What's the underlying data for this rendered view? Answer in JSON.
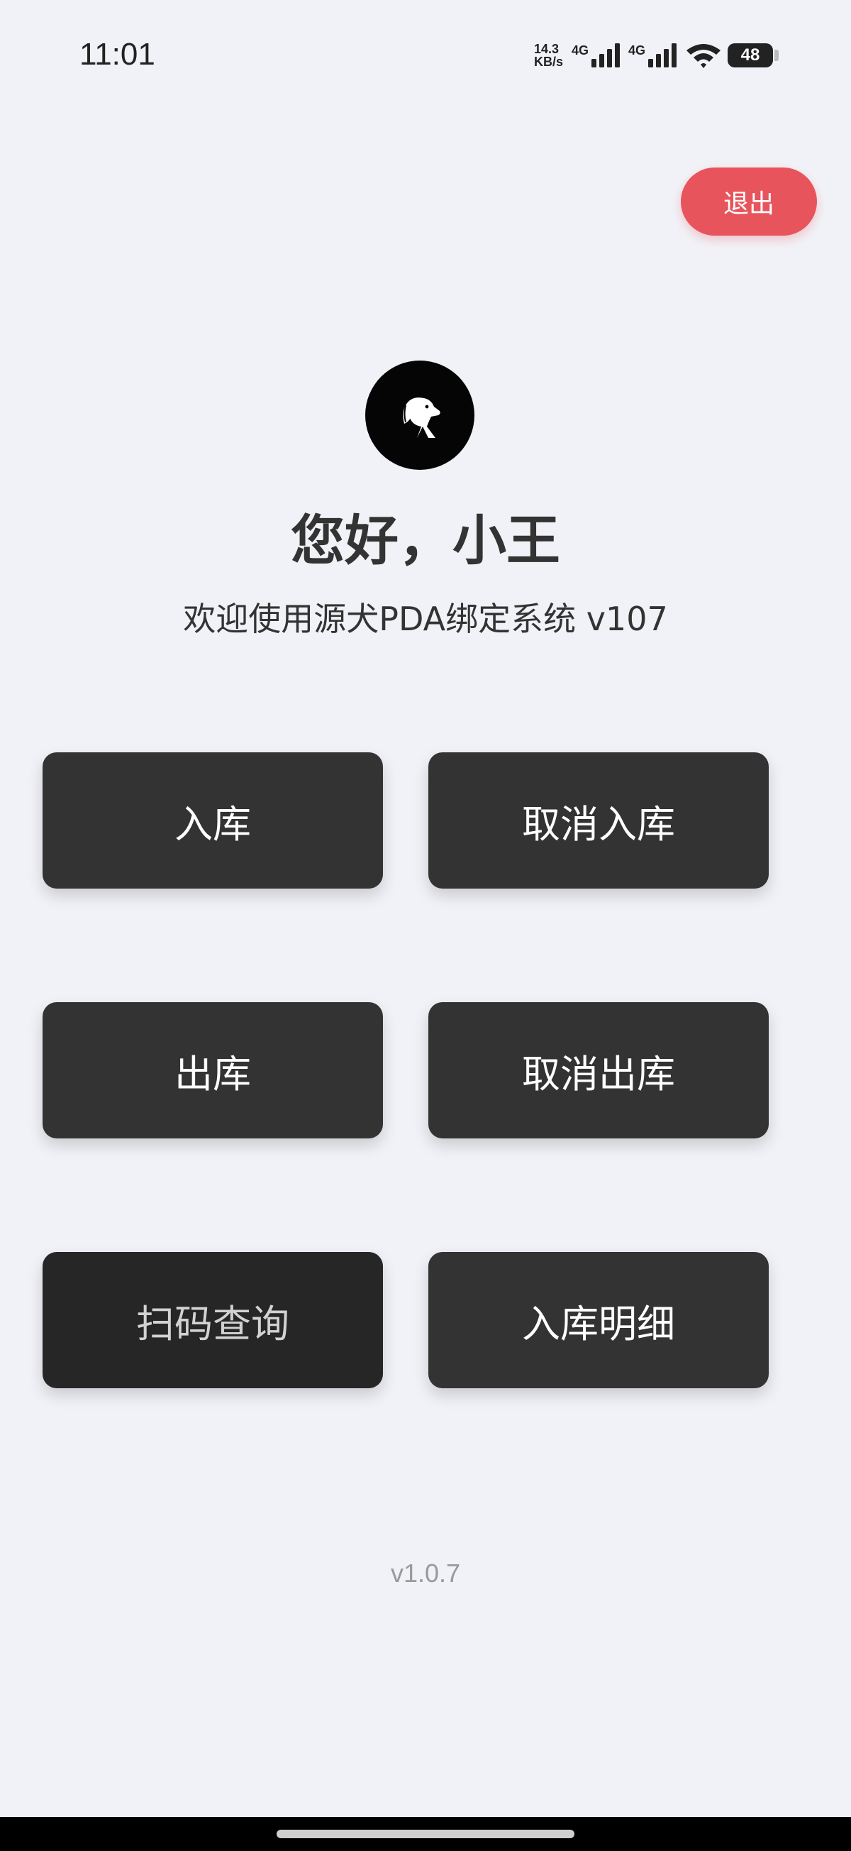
{
  "status_bar": {
    "time": "11:01",
    "net_speed_value": "14.3",
    "net_speed_unit": "KB/s",
    "signal_1_label": "4G",
    "signal_2_label": "4G",
    "battery_level": "48",
    "icons": [
      "signal-icon",
      "signal-icon",
      "wifi-icon",
      "battery-icon"
    ]
  },
  "header": {
    "logout_label": "退出"
  },
  "profile": {
    "logo_icon": "dog-logo-icon",
    "greeting": "您好，小王",
    "subtitle": "欢迎使用源犬PDA绑定系统 v107"
  },
  "menu": {
    "stock_in": "入库",
    "cancel_stock_in": "取消入库",
    "stock_out": "出库",
    "cancel_stock_out": "取消出库",
    "scan_query": "扫码查询",
    "stock_in_details": "入库明细"
  },
  "footer": {
    "version": "v1.0.7"
  },
  "colors": {
    "background": "#f1f2f7",
    "button": "#333333",
    "logout": "#e8545c",
    "footer_text": "#999999"
  }
}
